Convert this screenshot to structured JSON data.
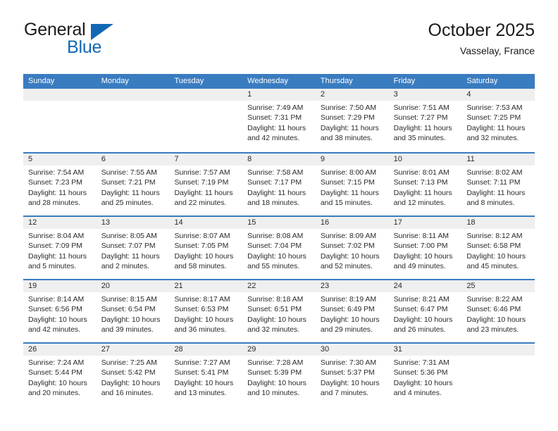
{
  "brand": {
    "name_top": "General",
    "name_bottom": "Blue",
    "triangle_color": "#1268b3",
    "text_color": "#1b1b1b"
  },
  "header": {
    "title": "October 2025",
    "subtitle": "Vasselay, France"
  },
  "theme": {
    "header_band": "#3a7cc0",
    "day_head_band": "#efefef",
    "row_divider": "#3a7cc0",
    "text": "#2b2b2b"
  },
  "calendar": {
    "weekdays": [
      "Sunday",
      "Monday",
      "Tuesday",
      "Wednesday",
      "Thursday",
      "Friday",
      "Saturday"
    ],
    "weeks": [
      [
        {
          "day": "",
          "empty": true,
          "sunrise": "",
          "sunset": "",
          "daylight_line1": "",
          "daylight_line2": ""
        },
        {
          "day": "",
          "empty": true,
          "sunrise": "",
          "sunset": "",
          "daylight_line1": "",
          "daylight_line2": ""
        },
        {
          "day": "",
          "empty": true,
          "sunrise": "",
          "sunset": "",
          "daylight_line1": "",
          "daylight_line2": ""
        },
        {
          "day": "1",
          "empty": false,
          "sunrise": "Sunrise: 7:49 AM",
          "sunset": "Sunset: 7:31 PM",
          "daylight_line1": "Daylight: 11 hours",
          "daylight_line2": "and 42 minutes."
        },
        {
          "day": "2",
          "empty": false,
          "sunrise": "Sunrise: 7:50 AM",
          "sunset": "Sunset: 7:29 PM",
          "daylight_line1": "Daylight: 11 hours",
          "daylight_line2": "and 38 minutes."
        },
        {
          "day": "3",
          "empty": false,
          "sunrise": "Sunrise: 7:51 AM",
          "sunset": "Sunset: 7:27 PM",
          "daylight_line1": "Daylight: 11 hours",
          "daylight_line2": "and 35 minutes."
        },
        {
          "day": "4",
          "empty": false,
          "sunrise": "Sunrise: 7:53 AM",
          "sunset": "Sunset: 7:25 PM",
          "daylight_line1": "Daylight: 11 hours",
          "daylight_line2": "and 32 minutes."
        }
      ],
      [
        {
          "day": "5",
          "empty": false,
          "sunrise": "Sunrise: 7:54 AM",
          "sunset": "Sunset: 7:23 PM",
          "daylight_line1": "Daylight: 11 hours",
          "daylight_line2": "and 28 minutes."
        },
        {
          "day": "6",
          "empty": false,
          "sunrise": "Sunrise: 7:55 AM",
          "sunset": "Sunset: 7:21 PM",
          "daylight_line1": "Daylight: 11 hours",
          "daylight_line2": "and 25 minutes."
        },
        {
          "day": "7",
          "empty": false,
          "sunrise": "Sunrise: 7:57 AM",
          "sunset": "Sunset: 7:19 PM",
          "daylight_line1": "Daylight: 11 hours",
          "daylight_line2": "and 22 minutes."
        },
        {
          "day": "8",
          "empty": false,
          "sunrise": "Sunrise: 7:58 AM",
          "sunset": "Sunset: 7:17 PM",
          "daylight_line1": "Daylight: 11 hours",
          "daylight_line2": "and 18 minutes."
        },
        {
          "day": "9",
          "empty": false,
          "sunrise": "Sunrise: 8:00 AM",
          "sunset": "Sunset: 7:15 PM",
          "daylight_line1": "Daylight: 11 hours",
          "daylight_line2": "and 15 minutes."
        },
        {
          "day": "10",
          "empty": false,
          "sunrise": "Sunrise: 8:01 AM",
          "sunset": "Sunset: 7:13 PM",
          "daylight_line1": "Daylight: 11 hours",
          "daylight_line2": "and 12 minutes."
        },
        {
          "day": "11",
          "empty": false,
          "sunrise": "Sunrise: 8:02 AM",
          "sunset": "Sunset: 7:11 PM",
          "daylight_line1": "Daylight: 11 hours",
          "daylight_line2": "and 8 minutes."
        }
      ],
      [
        {
          "day": "12",
          "empty": false,
          "sunrise": "Sunrise: 8:04 AM",
          "sunset": "Sunset: 7:09 PM",
          "daylight_line1": "Daylight: 11 hours",
          "daylight_line2": "and 5 minutes."
        },
        {
          "day": "13",
          "empty": false,
          "sunrise": "Sunrise: 8:05 AM",
          "sunset": "Sunset: 7:07 PM",
          "daylight_line1": "Daylight: 11 hours",
          "daylight_line2": "and 2 minutes."
        },
        {
          "day": "14",
          "empty": false,
          "sunrise": "Sunrise: 8:07 AM",
          "sunset": "Sunset: 7:05 PM",
          "daylight_line1": "Daylight: 10 hours",
          "daylight_line2": "and 58 minutes."
        },
        {
          "day": "15",
          "empty": false,
          "sunrise": "Sunrise: 8:08 AM",
          "sunset": "Sunset: 7:04 PM",
          "daylight_line1": "Daylight: 10 hours",
          "daylight_line2": "and 55 minutes."
        },
        {
          "day": "16",
          "empty": false,
          "sunrise": "Sunrise: 8:09 AM",
          "sunset": "Sunset: 7:02 PM",
          "daylight_line1": "Daylight: 10 hours",
          "daylight_line2": "and 52 minutes."
        },
        {
          "day": "17",
          "empty": false,
          "sunrise": "Sunrise: 8:11 AM",
          "sunset": "Sunset: 7:00 PM",
          "daylight_line1": "Daylight: 10 hours",
          "daylight_line2": "and 49 minutes."
        },
        {
          "day": "18",
          "empty": false,
          "sunrise": "Sunrise: 8:12 AM",
          "sunset": "Sunset: 6:58 PM",
          "daylight_line1": "Daylight: 10 hours",
          "daylight_line2": "and 45 minutes."
        }
      ],
      [
        {
          "day": "19",
          "empty": false,
          "sunrise": "Sunrise: 8:14 AM",
          "sunset": "Sunset: 6:56 PM",
          "daylight_line1": "Daylight: 10 hours",
          "daylight_line2": "and 42 minutes."
        },
        {
          "day": "20",
          "empty": false,
          "sunrise": "Sunrise: 8:15 AM",
          "sunset": "Sunset: 6:54 PM",
          "daylight_line1": "Daylight: 10 hours",
          "daylight_line2": "and 39 minutes."
        },
        {
          "day": "21",
          "empty": false,
          "sunrise": "Sunrise: 8:17 AM",
          "sunset": "Sunset: 6:53 PM",
          "daylight_line1": "Daylight: 10 hours",
          "daylight_line2": "and 36 minutes."
        },
        {
          "day": "22",
          "empty": false,
          "sunrise": "Sunrise: 8:18 AM",
          "sunset": "Sunset: 6:51 PM",
          "daylight_line1": "Daylight: 10 hours",
          "daylight_line2": "and 32 minutes."
        },
        {
          "day": "23",
          "empty": false,
          "sunrise": "Sunrise: 8:19 AM",
          "sunset": "Sunset: 6:49 PM",
          "daylight_line1": "Daylight: 10 hours",
          "daylight_line2": "and 29 minutes."
        },
        {
          "day": "24",
          "empty": false,
          "sunrise": "Sunrise: 8:21 AM",
          "sunset": "Sunset: 6:47 PM",
          "daylight_line1": "Daylight: 10 hours",
          "daylight_line2": "and 26 minutes."
        },
        {
          "day": "25",
          "empty": false,
          "sunrise": "Sunrise: 8:22 AM",
          "sunset": "Sunset: 6:46 PM",
          "daylight_line1": "Daylight: 10 hours",
          "daylight_line2": "and 23 minutes."
        }
      ],
      [
        {
          "day": "26",
          "empty": false,
          "sunrise": "Sunrise: 7:24 AM",
          "sunset": "Sunset: 5:44 PM",
          "daylight_line1": "Daylight: 10 hours",
          "daylight_line2": "and 20 minutes."
        },
        {
          "day": "27",
          "empty": false,
          "sunrise": "Sunrise: 7:25 AM",
          "sunset": "Sunset: 5:42 PM",
          "daylight_line1": "Daylight: 10 hours",
          "daylight_line2": "and 16 minutes."
        },
        {
          "day": "28",
          "empty": false,
          "sunrise": "Sunrise: 7:27 AM",
          "sunset": "Sunset: 5:41 PM",
          "daylight_line1": "Daylight: 10 hours",
          "daylight_line2": "and 13 minutes."
        },
        {
          "day": "29",
          "empty": false,
          "sunrise": "Sunrise: 7:28 AM",
          "sunset": "Sunset: 5:39 PM",
          "daylight_line1": "Daylight: 10 hours",
          "daylight_line2": "and 10 minutes."
        },
        {
          "day": "30",
          "empty": false,
          "sunrise": "Sunrise: 7:30 AM",
          "sunset": "Sunset: 5:37 PM",
          "daylight_line1": "Daylight: 10 hours",
          "daylight_line2": "and 7 minutes."
        },
        {
          "day": "31",
          "empty": false,
          "sunrise": "Sunrise: 7:31 AM",
          "sunset": "Sunset: 5:36 PM",
          "daylight_line1": "Daylight: 10 hours",
          "daylight_line2": "and 4 minutes."
        },
        {
          "day": "",
          "empty": true,
          "sunrise": "",
          "sunset": "",
          "daylight_line1": "",
          "daylight_line2": ""
        }
      ]
    ]
  }
}
